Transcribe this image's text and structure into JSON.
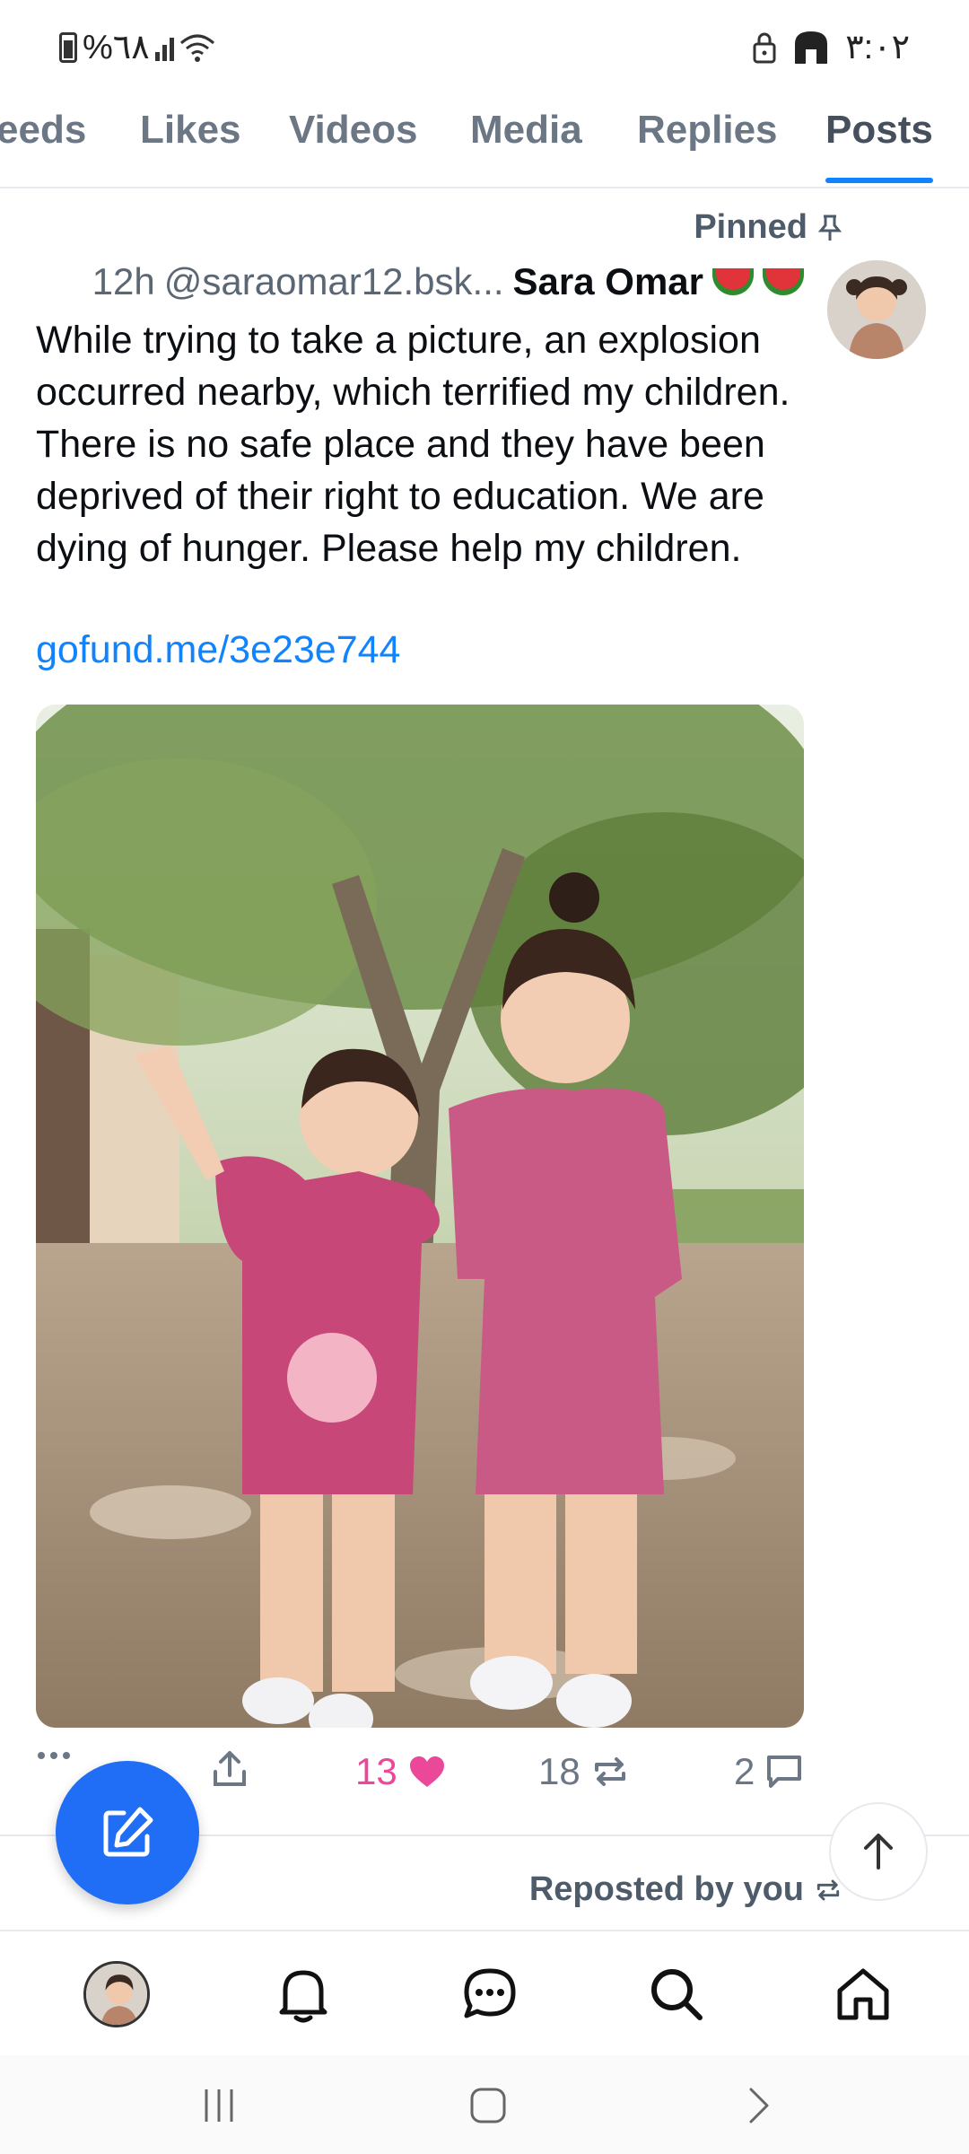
{
  "status_bar": {
    "battery": "%٦٨",
    "time": "٣:٠٢"
  },
  "tabs": [
    {
      "label": "eeds"
    },
    {
      "label": "Likes"
    },
    {
      "label": "Videos"
    },
    {
      "label": "Media"
    },
    {
      "label": "Replies"
    },
    {
      "label": "Posts",
      "active": true
    }
  ],
  "post": {
    "pinned_label": "Pinned",
    "time": "12h",
    "handle": "@saraomar12.bsk...",
    "author": "Sara Omar",
    "text": "While trying to take a picture, an explosion occurred nearby, which terrified my children. There is no safe place and they have been deprived of their right to education. We are dying of hunger. Please help my children.",
    "link": "gofund.me/3e23e744",
    "actions": {
      "likes": "13",
      "reposts": "18",
      "replies": "2"
    }
  },
  "next_post": {
    "repost_label": "Reposted by you"
  },
  "colors": {
    "accent": "#1083fe",
    "like": "#ec4899",
    "fab": "#1f6ef5"
  }
}
